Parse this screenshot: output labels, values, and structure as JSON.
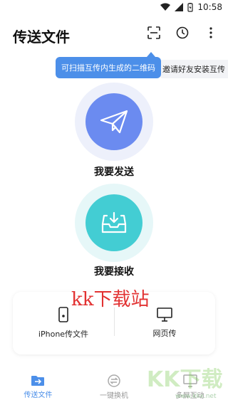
{
  "status": {
    "time": "10:58"
  },
  "header": {
    "title": "传送文件"
  },
  "tooltip": {
    "text": "可扫描互传内生成的二维码"
  },
  "invite": {
    "text": "邀请好友安装互传"
  },
  "actions": {
    "send_label": "我要发送",
    "receive_label": "我要接收"
  },
  "card": {
    "iphone_label": "iPhone传文件",
    "web_label": "网页传"
  },
  "watermark": {
    "text": "kk下载站",
    "logo": "KK下载",
    "url": "www.kkx.net"
  },
  "nav": {
    "items": [
      {
        "label": "传送文件",
        "icon": "folder-transfer-icon",
        "active": true
      },
      {
        "label": "一键换机",
        "icon": "switch-phone-icon",
        "active": false
      },
      {
        "label": "多屏互动",
        "icon": "multi-screen-icon",
        "active": false
      }
    ]
  },
  "colors": {
    "accent": "#4c8fe9",
    "send": "#6b8bf0",
    "receive": "#43cdd3"
  }
}
